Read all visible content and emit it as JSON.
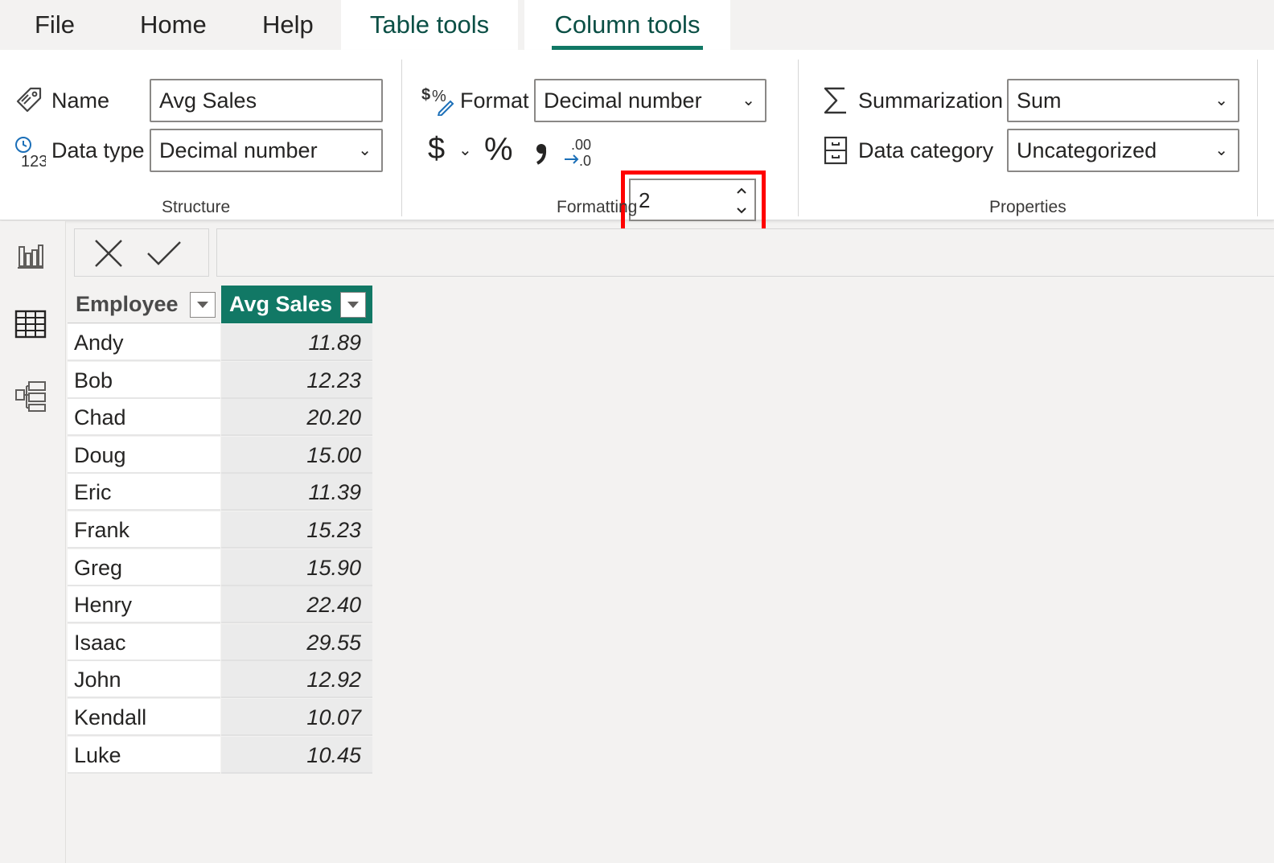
{
  "tabs": [
    {
      "label": "File"
    },
    {
      "label": "Home"
    },
    {
      "label": "Help"
    },
    {
      "label": "Table tools"
    },
    {
      "label": "Column tools"
    }
  ],
  "structure": {
    "name_label": "Name",
    "name_value": "Avg Sales",
    "datatype_label": "Data type",
    "datatype_value": "Decimal number",
    "group_label": "Structure"
  },
  "formatting": {
    "format_label": "Format",
    "format_value": "Decimal number",
    "currency_symbol": "$",
    "percent_symbol": "%",
    "comma_symbol": "❟",
    "decimal_places": "2",
    "group_label": "Formatting"
  },
  "properties": {
    "summarization_label": "Summarization",
    "summarization_value": "Sum",
    "datacategory_label": "Data category",
    "datacategory_value": "Uncategorized",
    "group_label": "Properties"
  },
  "table": {
    "columns": [
      "Employee",
      "Avg Sales"
    ],
    "rows": [
      {
        "employee": "Andy",
        "avg": "11.89"
      },
      {
        "employee": "Bob",
        "avg": "12.23"
      },
      {
        "employee": "Chad",
        "avg": "20.20"
      },
      {
        "employee": "Doug",
        "avg": "15.00"
      },
      {
        "employee": "Eric",
        "avg": "11.39"
      },
      {
        "employee": "Frank",
        "avg": "15.23"
      },
      {
        "employee": "Greg",
        "avg": "15.90"
      },
      {
        "employee": "Henry",
        "avg": "22.40"
      },
      {
        "employee": "Isaac",
        "avg": "29.55"
      },
      {
        "employee": "John",
        "avg": "12.92"
      },
      {
        "employee": "Kendall",
        "avg": "10.07"
      },
      {
        "employee": "Luke",
        "avg": "10.45"
      }
    ]
  },
  "colors": {
    "accent": "#117865",
    "highlight": "#ff0000"
  }
}
